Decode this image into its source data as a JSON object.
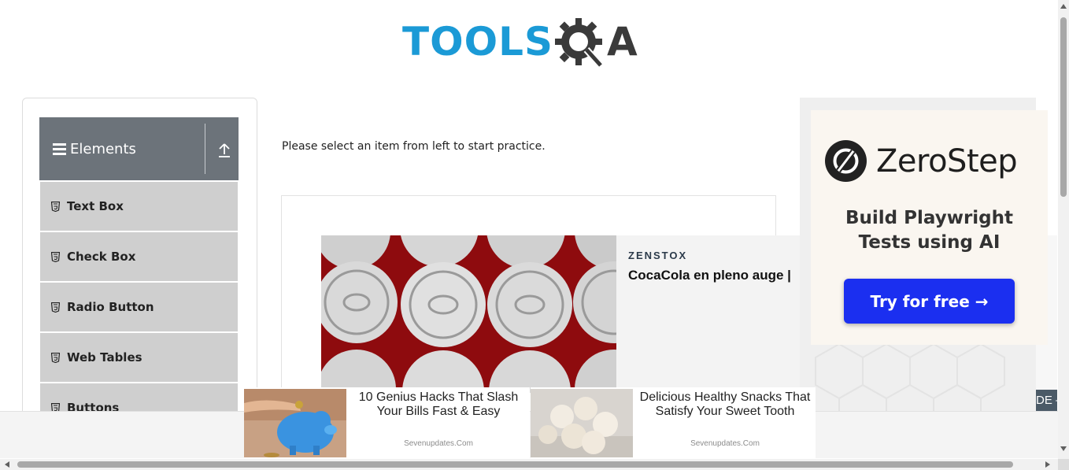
{
  "header": {
    "logo_part1": "TOOLS",
    "logo_part2": "A",
    "logo_colors": {
      "tools": "#1b9ad6",
      "qa": "#3a3a3a"
    }
  },
  "sidebar": {
    "group_title": "Elements",
    "items": [
      {
        "label": "Text Box",
        "icon": "html5-icon"
      },
      {
        "label": "Check Box",
        "icon": "html5-icon"
      },
      {
        "label": "Radio Button",
        "icon": "html5-icon"
      },
      {
        "label": "Web Tables",
        "icon": "html5-icon"
      },
      {
        "label": "Buttons",
        "icon": "html5-icon"
      }
    ],
    "header_color": "#6c737a",
    "item_color": "#cfcfcf"
  },
  "main": {
    "hint": "Please select an item from left to start practice."
  },
  "ads": {
    "cans_ad": {
      "brand": "ZENSTOX",
      "headline": "CocaCola en pleno auge |"
    },
    "zerostep": {
      "name": "ZeroStep",
      "tagline_line1": "Build Playwright",
      "tagline_line2": "Tests using AI",
      "cta": "Try for free →",
      "cta_color": "#1b2ff0"
    },
    "side_tab_text": "DE –",
    "bottom": [
      {
        "title": "10 Genius Hacks That Slash Your Bills Fast & Easy",
        "source": "Sevenupdates.Com"
      },
      {
        "title": "Delicious Healthy Snacks That Satisfy Your Sweet Tooth",
        "source": "Sevenupdates.Com"
      }
    ]
  }
}
